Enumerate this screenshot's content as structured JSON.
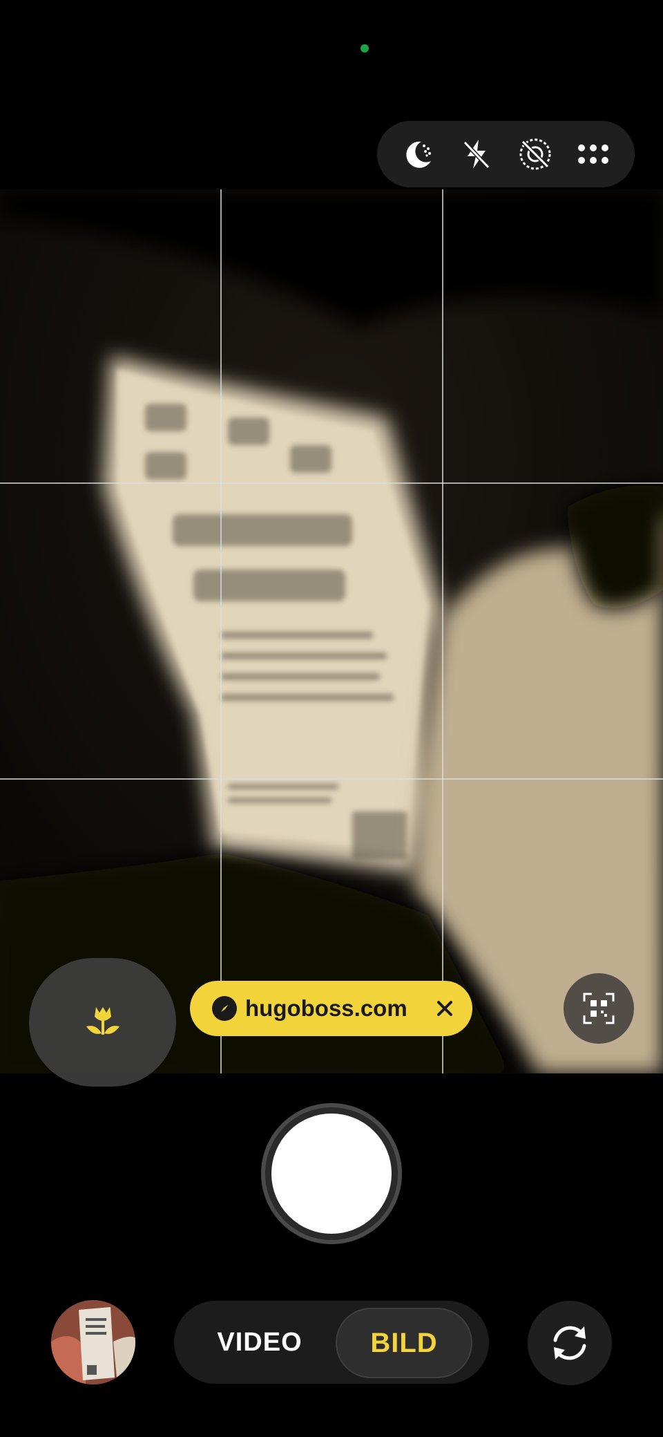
{
  "camera": {
    "url_chip": {
      "text": "hugoboss.com"
    },
    "modes": {
      "video": "VIDEO",
      "photo": "BILD",
      "selected": "BILD"
    },
    "top_controls": [
      "night-mode-icon",
      "flash-off-icon",
      "motion-photo-off-icon",
      "more-icon"
    ],
    "colors": {
      "accent": "#f4d43b",
      "indicator": "#1ea446"
    }
  }
}
